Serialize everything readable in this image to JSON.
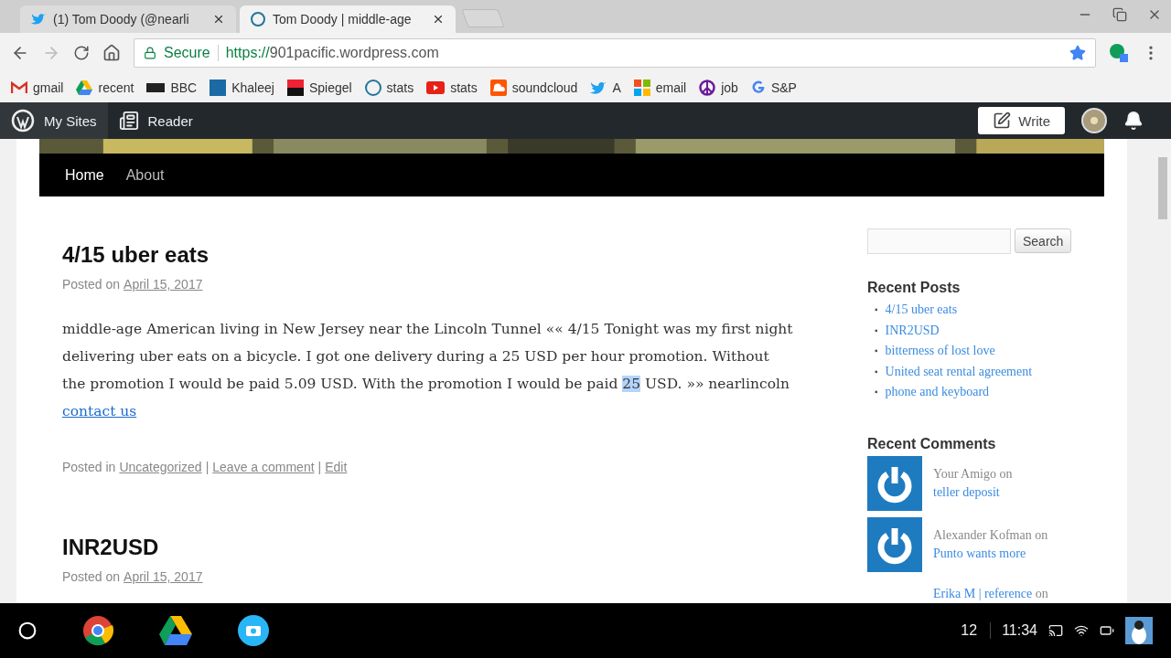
{
  "browser": {
    "tabs": [
      {
        "title": "(1) Tom Doody (@nearli",
        "selected": false
      },
      {
        "title": "Tom Doody | middle-age",
        "selected": true
      }
    ],
    "address": {
      "secure_label": "Secure",
      "scheme": "https://",
      "host": "901pacific.wordpress.com",
      "starred": true
    },
    "bookmarks": [
      "gmail",
      "recent",
      "BBC",
      "Khaleej",
      "Spiegel",
      "stats",
      "stats",
      "soundcloud",
      "A",
      "email",
      "job",
      "S&P"
    ]
  },
  "admin_bar": {
    "items": [
      {
        "label": "My Sites",
        "selected": true
      },
      {
        "label": "Reader",
        "selected": false
      }
    ],
    "write_button": "Write"
  },
  "site_nav": [
    {
      "label": "Home",
      "selected": true
    },
    {
      "label": "About",
      "selected": false
    }
  ],
  "posts": [
    {
      "title": "4/15 uber eats",
      "meta_label": "Posted on",
      "date": "April 15, 2017",
      "body": {
        "text_before": "middle-age American living in New Jersey near the Lincoln Tunnel «« 4/15 Tonight was my first night delivering uber eats on a bicycle. I got one delivery during a 25 USD per hour promotion. Without the promotion I would be paid 5.09 USD. With the promotion I would be paid ",
        "selected_text": "25",
        "text_after": " USD. »» nearlincoln ",
        "link": "contact us"
      },
      "footer": [
        {
          "kind": "text",
          "text": "Posted in"
        },
        {
          "kind": "link",
          "text": "Uncategorized"
        },
        {
          "kind": "text",
          "text": "|"
        },
        {
          "kind": "link",
          "text": "Leave a comment"
        },
        {
          "kind": "text",
          "text": "|"
        },
        {
          "kind": "link",
          "text": "Edit"
        }
      ]
    },
    {
      "title": "INR2USD",
      "meta_label": "Posted on",
      "date": "April 15, 2017"
    }
  ],
  "sidebar": {
    "search_button": "Search",
    "recent_posts_title": "Recent Posts",
    "recent_posts": [
      {
        "bullet": "▪",
        "title": "4/15 uber eats"
      },
      {
        "bullet": "▪",
        "title": "INR2USD"
      },
      {
        "bullet": "▪",
        "title": "bitterness of lost love"
      },
      {
        "bullet": "▪",
        "title": "United seat rental agreement"
      },
      {
        "bullet": "▪",
        "title": "phone and keyboard"
      }
    ],
    "recent_comments_title": "Recent Comments",
    "recent_comments": [
      {
        "kind": "gravatar",
        "parts": [
          {
            "kind": "text",
            "text": "Your Amigo on "
          },
          {
            "kind": "link",
            "text": "teller deposit"
          }
        ]
      },
      {
        "kind": "gravatar",
        "parts": [
          {
            "kind": "text",
            "text": "Alexander Kofman on "
          },
          {
            "kind": "link",
            "text": "Punto wants more"
          }
        ]
      },
      {
        "kind": "plain",
        "parts": [
          {
            "kind": "link",
            "text": "Erika M | reference"
          },
          {
            "kind": "text",
            "text": " on"
          }
        ]
      }
    ]
  },
  "taskbar": {
    "notification_count": "12",
    "time": "11:34"
  }
}
